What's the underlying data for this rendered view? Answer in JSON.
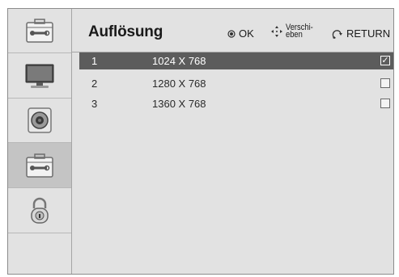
{
  "header": {
    "title": "Auflösung",
    "ok_label": "OK",
    "move_label_line1": "Verschi-",
    "move_label_line2": "eben",
    "return_label": "RETURN"
  },
  "sidebar": {
    "items": [
      {
        "name": "tools",
        "icon": "toolbox-icon"
      },
      {
        "name": "picture",
        "icon": "monitor-icon"
      },
      {
        "name": "audio",
        "icon": "speaker-icon"
      },
      {
        "name": "option",
        "icon": "toolbox-icon",
        "selected": true
      },
      {
        "name": "lock",
        "icon": "lock-icon"
      }
    ]
  },
  "resolutions": [
    {
      "num": "1",
      "label": "1024 X 768",
      "mark": "✓",
      "checked": true
    },
    {
      "num": "2",
      "label": "1280 X 768",
      "mark": "",
      "checked": false
    },
    {
      "num": "3",
      "label": "1360 X 768",
      "mark": "",
      "checked": false
    }
  ],
  "colors": {
    "selected_row": "#5c5c5c",
    "panel": "#e2e2e2"
  }
}
